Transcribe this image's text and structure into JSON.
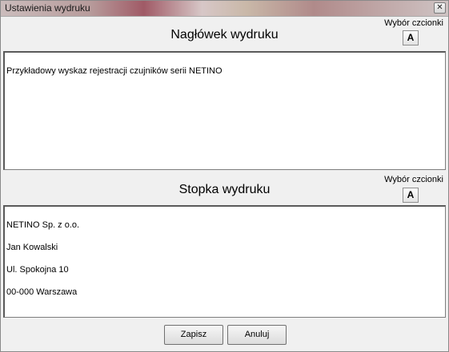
{
  "window": {
    "title": "Ustawienia wydruku",
    "close_glyph": "✕"
  },
  "header_section": {
    "title": "Nagłówek wydruku",
    "font_picker_label": "Wybór czcionki",
    "font_button_label": "A",
    "text": "Przykładowy wyskaz rejestracji czujników serii NETINO"
  },
  "footer_section": {
    "title": "Stopka wydruku",
    "font_picker_label": "Wybór czcionki",
    "font_button_label": "A",
    "lines": [
      "NETINO Sp. z o.o.",
      "Jan Kowalski",
      "Ul. Spokojna 10",
      "00-000 Warszawa"
    ]
  },
  "buttons": {
    "save_label": "Zapisz",
    "cancel_label": "Anuluj"
  }
}
